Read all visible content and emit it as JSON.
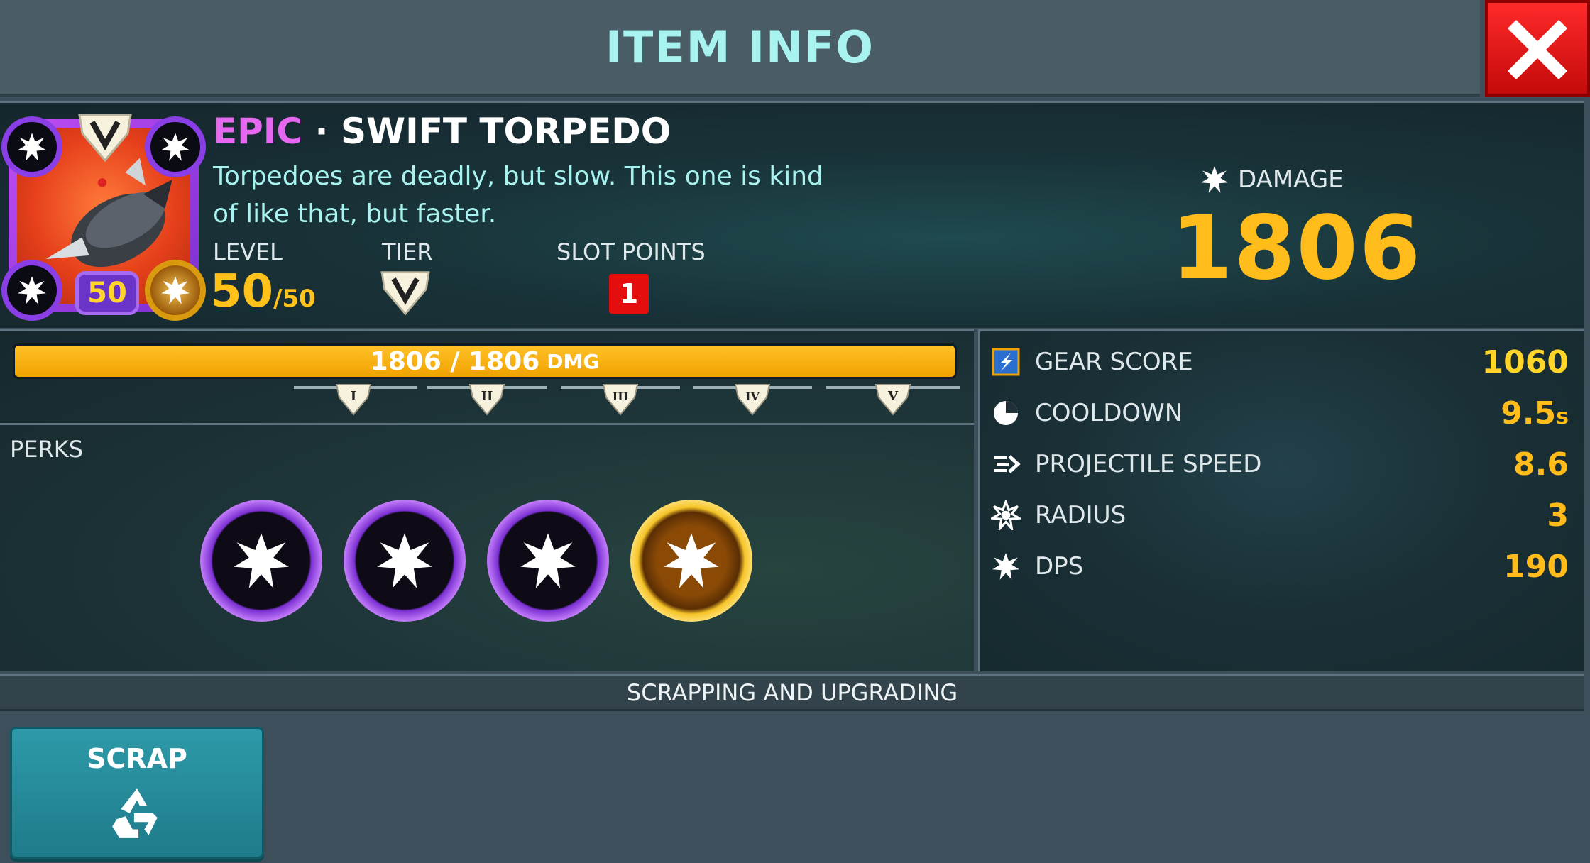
{
  "header": {
    "title": "ITEM INFO"
  },
  "item": {
    "rarity": "EPIC",
    "separator": "·",
    "name": "SWIFT TORPEDO",
    "description": "Torpedoes are deadly, but slow. This one is kind of like that, but faster.",
    "level_badge": "50",
    "level_label": "LEVEL",
    "level_current": "50",
    "level_max": "/50",
    "tier_label": "TIER",
    "tier_value": "V",
    "slot_points_label": "SLOT POINTS",
    "slot_points_value": "1",
    "damage_label": "DAMAGE",
    "damage_value": "1806"
  },
  "progress": {
    "text": "1806 / 1806",
    "unit": "DMG",
    "fill_fraction": 1.0,
    "tiers": [
      "I",
      "II",
      "III",
      "IV",
      "V"
    ]
  },
  "perks": {
    "label": "PERKS",
    "items": [
      {
        "kind": "epic",
        "icon": "burst-icon"
      },
      {
        "kind": "epic",
        "icon": "burst-icon"
      },
      {
        "kind": "epic",
        "icon": "burst-icon"
      },
      {
        "kind": "gold",
        "icon": "burst-icon"
      }
    ]
  },
  "stats": [
    {
      "name": "GEAR SCORE",
      "value": "1060",
      "suffix": "",
      "icon": "gear-score-icon"
    },
    {
      "name": "COOLDOWN",
      "value": "9.5",
      "suffix": "s",
      "icon": "cooldown-icon"
    },
    {
      "name": "PROJECTILE SPEED",
      "value": "8.6",
      "suffix": "",
      "icon": "projectile-speed-icon"
    },
    {
      "name": "RADIUS",
      "value": "3",
      "suffix": "",
      "icon": "radius-icon"
    },
    {
      "name": "DPS",
      "value": "190",
      "suffix": "",
      "icon": "dps-icon"
    }
  ],
  "section": {
    "title": "SCRAPPING AND UPGRADING"
  },
  "scrap": {
    "label": "SCRAP",
    "icon": "recycle-icon"
  },
  "colors": {
    "epic": "#e667f0",
    "gold_value": "#ffbc1a",
    "progress_fill": "#f0a200",
    "close_red": "#e41414",
    "description": "#a8f2ef"
  }
}
